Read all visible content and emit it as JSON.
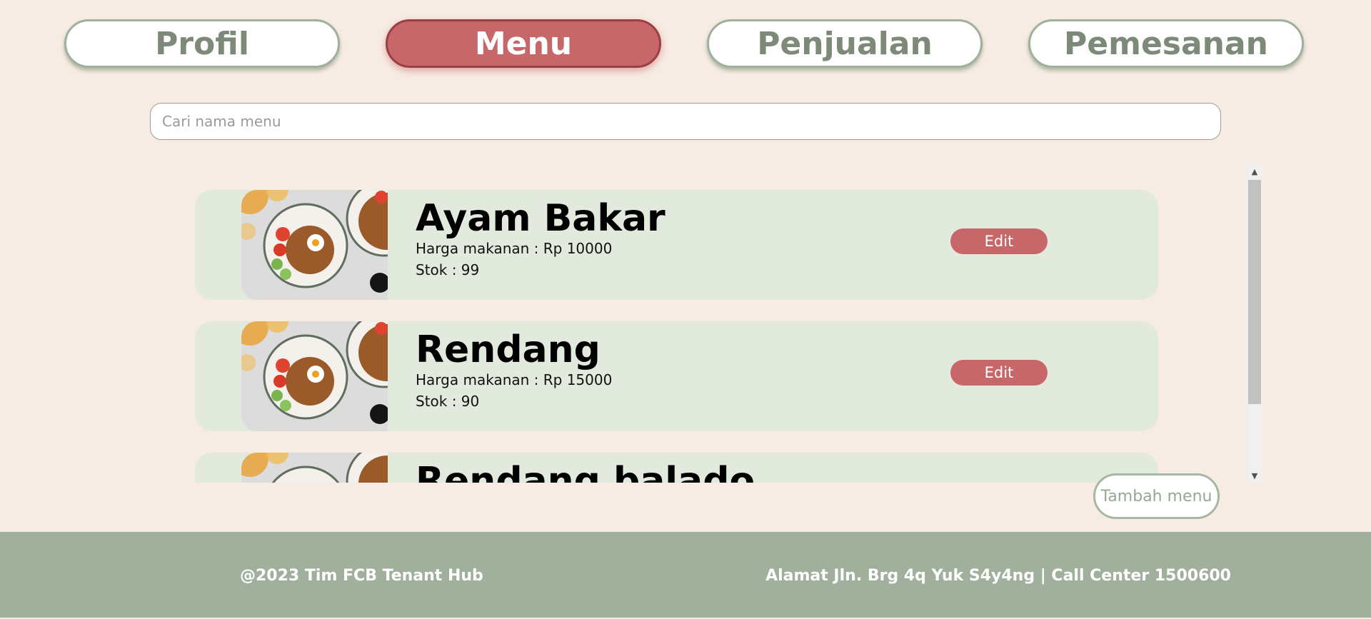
{
  "nav": {
    "tabs": [
      {
        "label": "Profil",
        "active": false
      },
      {
        "label": "Menu",
        "active": true
      },
      {
        "label": "Penjualan",
        "active": false
      },
      {
        "label": "Pemesanan",
        "active": false
      }
    ]
  },
  "search": {
    "placeholder": "Cari nama menu",
    "value": ""
  },
  "menu_items": [
    {
      "name": "Ayam Bakar",
      "price_text": "Harga makanan : Rp 10000",
      "stock_text": "Stok : 99",
      "edit_label": "Edit"
    },
    {
      "name": "Rendang",
      "price_text": "Harga makanan : Rp 15000",
      "stock_text": "Stok : 90",
      "edit_label": "Edit"
    },
    {
      "name": "Rendang balado",
      "price_text": "",
      "stock_text": "",
      "edit_label": ""
    }
  ],
  "add_button": {
    "label": "Tambah menu"
  },
  "footer": {
    "left": "@2023 Tim FCB Tenant Hub",
    "right": "Alamat Jln. Brg 4q Yuk S4y4ng | Call Center 1500600"
  },
  "colors": {
    "background": "#f7ece3",
    "accent": "#c86769",
    "card": "#e2e9dd",
    "footer": "#a1b09d",
    "tab_text": "#7e8a79"
  },
  "icons": {
    "scroll_up": "scroll-up-arrow-icon",
    "scroll_down": "scroll-down-arrow-icon",
    "food_image": "food-photo"
  }
}
